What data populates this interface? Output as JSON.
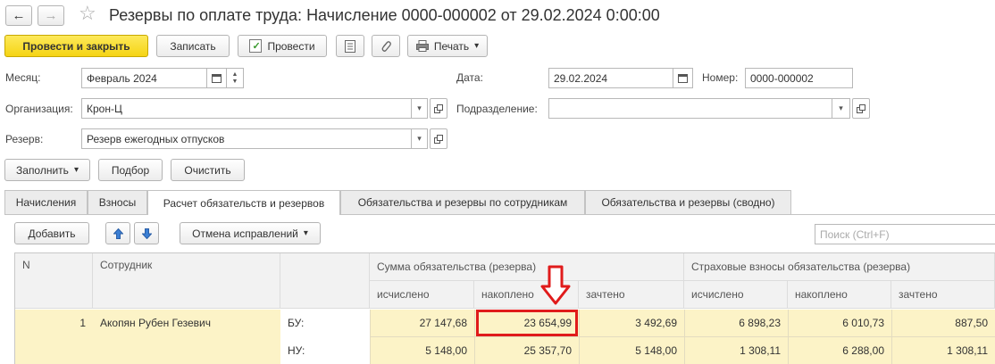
{
  "window": {
    "title": "Резервы по оплате труда: Начисление 0000-000002 от 29.02.2024 0:00:00",
    "nav_back": "←",
    "nav_forward": "→",
    "star": "☆"
  },
  "toolbar": {
    "post_close": "Провести и закрыть",
    "save": "Записать",
    "post": "Провести",
    "print": "Печать",
    "print_arrow": "▾"
  },
  "form": {
    "month_label": "Месяц:",
    "month_value": "Февраль 2024",
    "date_label": "Дата:",
    "date_value": "29.02.2024",
    "number_label": "Номер:",
    "number_value": "0000-000002",
    "org_label": "Организация:",
    "org_value": "Крон-Ц",
    "dept_label": "Подразделение:",
    "dept_value": "",
    "reserve_label": "Резерв:",
    "reserve_value": "Резерв ежегодных отпусков"
  },
  "actions": {
    "fill": "Заполнить",
    "fill_arrow": "▾",
    "pick": "Подбор",
    "clear": "Очистить"
  },
  "tabs": [
    {
      "label": "Начисления"
    },
    {
      "label": "Взносы"
    },
    {
      "label": "Расчет обязательств и резервов"
    },
    {
      "label": "Обязательства и резервы по сотрудникам"
    },
    {
      "label": "Обязательства и резервы (сводно)"
    }
  ],
  "table_toolbar": {
    "add": "Добавить",
    "cancel_fixes": "Отмена исправлений",
    "cancel_arrow": "▾",
    "search_placeholder": "Поиск (Ctrl+F)"
  },
  "table": {
    "headers": {
      "n": "N",
      "employee": "Сотрудник",
      "liability_group": "Сумма обязательства (резерва)",
      "insurance_group": "Страховые взносы обязательства (резерва)",
      "accrued": "исчислено",
      "accumulated": "накоплено",
      "offset": "зачтено"
    },
    "rows": [
      {
        "n": "1",
        "employee": "Акопян Рубен Гезевич",
        "bu_label": "БУ:",
        "nu_label": "НУ:",
        "bu": [
          "27 147,68",
          "23 654,99",
          "3 492,69",
          "6 898,23",
          "6 010,73",
          "887,50"
        ],
        "nu": [
          "5 148,00",
          "25 357,70",
          "5 148,00",
          "1 308,11",
          "6 288,00",
          "1 308,11"
        ]
      }
    ]
  },
  "colors": {
    "highlight_border": "#e01b1b",
    "arrow": "#e01b1b",
    "primary_button": "#f5d414",
    "selected_row": "#fcf3c7"
  }
}
